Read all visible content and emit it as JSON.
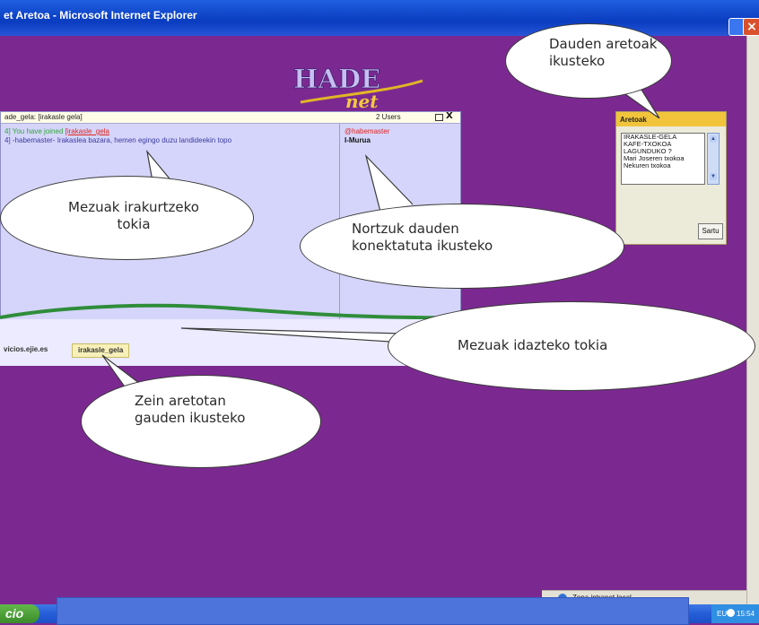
{
  "window": {
    "title": "et Aretoa - Microsoft Internet Explorer",
    "close_glyph": "×"
  },
  "logo": {
    "top_text": "HADE",
    "bottom_text": "net"
  },
  "chat": {
    "header_title": "ade_gela: [irakasle gela]",
    "users_count": "2 Users",
    "close_glyph": "X",
    "messages": [
      {
        "prefix": "4] You have joined ",
        "room": "[irakasle_gela",
        "color": "#33a63a"
      },
      {
        "text": "4] -habemaster- Irakaslea bazara, hemen egingo duzu landideekin topo",
        "color": "#3a3aa0"
      }
    ],
    "users": [
      "@habemaster",
      "I-Murua"
    ]
  },
  "tabs": {
    "items": [
      "vicios.ejie.es",
      "irakasle_gela"
    ]
  },
  "aretoak": {
    "title": "Aretoak",
    "rooms": [
      "IRAKASLE-GELA",
      "KAFE-TXOKOA",
      "LAGUNDUKO ?",
      "Mari Joseren txokoa",
      "Nekuren txokoa"
    ],
    "enter_label": "Sartu"
  },
  "callouts": {
    "dauden_aretoak": [
      "Dauden aretoak",
      "ikusteko"
    ],
    "irakurtzeko": [
      "Mezuak irakurtzeko",
      "tokia"
    ],
    "konektatuta": [
      "Nortzuk dauden",
      "konektatuta ikusteko"
    ],
    "idazteko": [
      "Mezuak idazteko tokia"
    ],
    "aretotan": [
      "Zein aretotan",
      "gauden ikusteko"
    ]
  },
  "statusbar": {
    "zone": "Zona intranet local"
  },
  "taskbar": {
    "start_label": "cio",
    "lang": "EU",
    "clock": "15:54"
  }
}
